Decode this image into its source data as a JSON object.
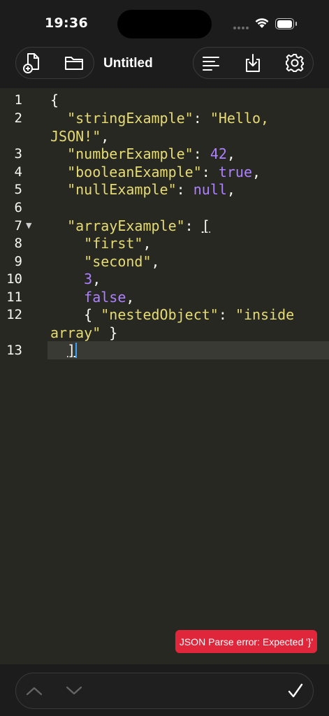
{
  "status_bar": {
    "time": "19:36"
  },
  "toolbar": {
    "title": "Untitled",
    "icons": [
      "new-file-icon",
      "folder-icon",
      "format-icon",
      "download-icon",
      "gear-icon"
    ]
  },
  "editor": {
    "line_numbers": [
      "1",
      "2",
      "3",
      "4",
      "5",
      "6",
      "7",
      "8",
      "9",
      "10",
      "11",
      "12",
      "13"
    ],
    "lines": {
      "l1": {
        "p1": "{"
      },
      "l2": {
        "key": "\"stringExample\"",
        "sep": ": ",
        "val": "\"Hello,"
      },
      "l2b": {
        "val": "JSON!\"",
        "end": ","
      },
      "l3": {
        "key": "\"numberExample\"",
        "sep": ": ",
        "val": "42",
        "end": ","
      },
      "l4": {
        "key": "\"booleanExample\"",
        "sep": ": ",
        "val": "true",
        "end": ","
      },
      "l5": {
        "key": "\"nullExample\"",
        "sep": ": ",
        "val": "null",
        "end": ","
      },
      "l7": {
        "key": "\"arrayExample\"",
        "sep": ": ",
        "val": "["
      },
      "l8": {
        "val": "\"first\"",
        "end": ","
      },
      "l9": {
        "val": "\"second\"",
        "end": ","
      },
      "l10": {
        "val": "3",
        "end": ","
      },
      "l11": {
        "val": "false",
        "end": ","
      },
      "l12": {
        "open": "{ ",
        "key": "\"nestedObject\"",
        "sep": ": ",
        "val": "\"inside"
      },
      "l12b": {
        "val": "array\"",
        "end": " }"
      },
      "l13": {
        "p1": "]"
      }
    }
  },
  "toast": {
    "message": "JSON Parse error: Expected '}'"
  },
  "bottom_bar": {
    "icons": [
      "chevron-up-icon",
      "chevron-down-icon",
      "checkmark-icon"
    ]
  },
  "colors": {
    "background": "#272822",
    "string": "#e6db74",
    "number": "#ae81ff",
    "error": "#e0263b",
    "cursor": "#3aa0ff"
  }
}
